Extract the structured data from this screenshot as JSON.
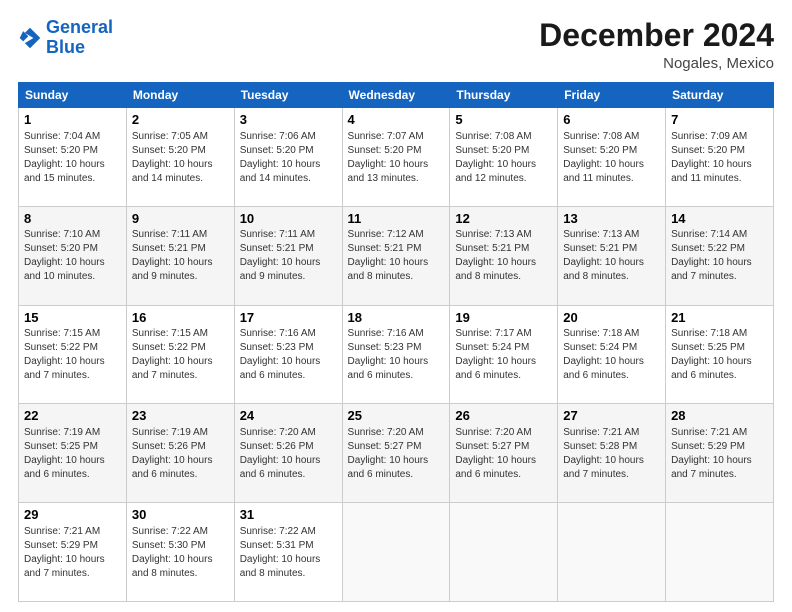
{
  "logo": {
    "line1": "General",
    "line2": "Blue"
  },
  "header": {
    "month": "December 2024",
    "location": "Nogales, Mexico"
  },
  "days_of_week": [
    "Sunday",
    "Monday",
    "Tuesday",
    "Wednesday",
    "Thursday",
    "Friday",
    "Saturday"
  ],
  "weeks": [
    [
      {
        "day": "1",
        "info": "Sunrise: 7:04 AM\nSunset: 5:20 PM\nDaylight: 10 hours\nand 15 minutes."
      },
      {
        "day": "2",
        "info": "Sunrise: 7:05 AM\nSunset: 5:20 PM\nDaylight: 10 hours\nand 14 minutes."
      },
      {
        "day": "3",
        "info": "Sunrise: 7:06 AM\nSunset: 5:20 PM\nDaylight: 10 hours\nand 14 minutes."
      },
      {
        "day": "4",
        "info": "Sunrise: 7:07 AM\nSunset: 5:20 PM\nDaylight: 10 hours\nand 13 minutes."
      },
      {
        "day": "5",
        "info": "Sunrise: 7:08 AM\nSunset: 5:20 PM\nDaylight: 10 hours\nand 12 minutes."
      },
      {
        "day": "6",
        "info": "Sunrise: 7:08 AM\nSunset: 5:20 PM\nDaylight: 10 hours\nand 11 minutes."
      },
      {
        "day": "7",
        "info": "Sunrise: 7:09 AM\nSunset: 5:20 PM\nDaylight: 10 hours\nand 11 minutes."
      }
    ],
    [
      {
        "day": "8",
        "info": "Sunrise: 7:10 AM\nSunset: 5:20 PM\nDaylight: 10 hours\nand 10 minutes."
      },
      {
        "day": "9",
        "info": "Sunrise: 7:11 AM\nSunset: 5:21 PM\nDaylight: 10 hours\nand 9 minutes."
      },
      {
        "day": "10",
        "info": "Sunrise: 7:11 AM\nSunset: 5:21 PM\nDaylight: 10 hours\nand 9 minutes."
      },
      {
        "day": "11",
        "info": "Sunrise: 7:12 AM\nSunset: 5:21 PM\nDaylight: 10 hours\nand 8 minutes."
      },
      {
        "day": "12",
        "info": "Sunrise: 7:13 AM\nSunset: 5:21 PM\nDaylight: 10 hours\nand 8 minutes."
      },
      {
        "day": "13",
        "info": "Sunrise: 7:13 AM\nSunset: 5:21 PM\nDaylight: 10 hours\nand 8 minutes."
      },
      {
        "day": "14",
        "info": "Sunrise: 7:14 AM\nSunset: 5:22 PM\nDaylight: 10 hours\nand 7 minutes."
      }
    ],
    [
      {
        "day": "15",
        "info": "Sunrise: 7:15 AM\nSunset: 5:22 PM\nDaylight: 10 hours\nand 7 minutes."
      },
      {
        "day": "16",
        "info": "Sunrise: 7:15 AM\nSunset: 5:22 PM\nDaylight: 10 hours\nand 7 minutes."
      },
      {
        "day": "17",
        "info": "Sunrise: 7:16 AM\nSunset: 5:23 PM\nDaylight: 10 hours\nand 6 minutes."
      },
      {
        "day": "18",
        "info": "Sunrise: 7:16 AM\nSunset: 5:23 PM\nDaylight: 10 hours\nand 6 minutes."
      },
      {
        "day": "19",
        "info": "Sunrise: 7:17 AM\nSunset: 5:24 PM\nDaylight: 10 hours\nand 6 minutes."
      },
      {
        "day": "20",
        "info": "Sunrise: 7:18 AM\nSunset: 5:24 PM\nDaylight: 10 hours\nand 6 minutes."
      },
      {
        "day": "21",
        "info": "Sunrise: 7:18 AM\nSunset: 5:25 PM\nDaylight: 10 hours\nand 6 minutes."
      }
    ],
    [
      {
        "day": "22",
        "info": "Sunrise: 7:19 AM\nSunset: 5:25 PM\nDaylight: 10 hours\nand 6 minutes."
      },
      {
        "day": "23",
        "info": "Sunrise: 7:19 AM\nSunset: 5:26 PM\nDaylight: 10 hours\nand 6 minutes."
      },
      {
        "day": "24",
        "info": "Sunrise: 7:20 AM\nSunset: 5:26 PM\nDaylight: 10 hours\nand 6 minutes."
      },
      {
        "day": "25",
        "info": "Sunrise: 7:20 AM\nSunset: 5:27 PM\nDaylight: 10 hours\nand 6 minutes."
      },
      {
        "day": "26",
        "info": "Sunrise: 7:20 AM\nSunset: 5:27 PM\nDaylight: 10 hours\nand 6 minutes."
      },
      {
        "day": "27",
        "info": "Sunrise: 7:21 AM\nSunset: 5:28 PM\nDaylight: 10 hours\nand 7 minutes."
      },
      {
        "day": "28",
        "info": "Sunrise: 7:21 AM\nSunset: 5:29 PM\nDaylight: 10 hours\nand 7 minutes."
      }
    ],
    [
      {
        "day": "29",
        "info": "Sunrise: 7:21 AM\nSunset: 5:29 PM\nDaylight: 10 hours\nand 7 minutes."
      },
      {
        "day": "30",
        "info": "Sunrise: 7:22 AM\nSunset: 5:30 PM\nDaylight: 10 hours\nand 8 minutes."
      },
      {
        "day": "31",
        "info": "Sunrise: 7:22 AM\nSunset: 5:31 PM\nDaylight: 10 hours\nand 8 minutes."
      },
      null,
      null,
      null,
      null
    ]
  ]
}
